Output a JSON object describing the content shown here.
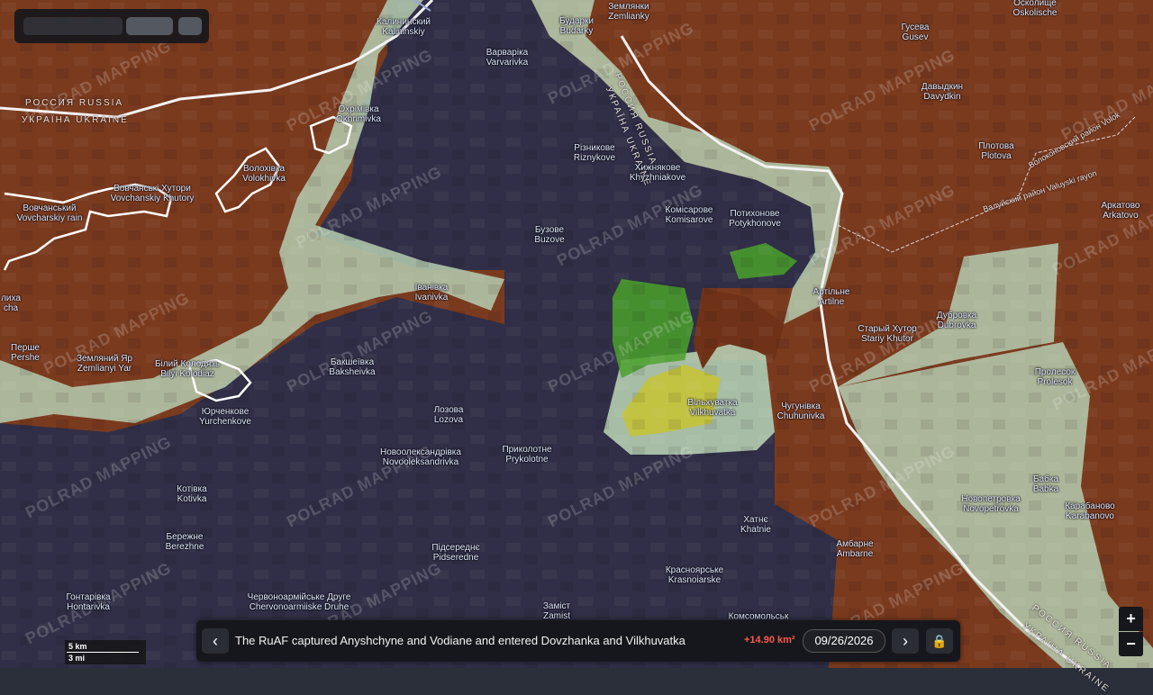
{
  "map": {
    "watermark": "POLRAD MAPPING",
    "border_labels": {
      "russia": "РОССИЯ RUSSIA",
      "ukraine": "УКРАЇНА UKRAINE",
      "russia_diag": "РОССИЯ RUSSIA",
      "ukraine_diag": "УКРАЇНА UKRAINE"
    },
    "district_labels": {
      "volokonovsky": "Волоконовский район Volok",
      "valuysky": "Валуйский район Valuyski rayon"
    },
    "places": [
      {
        "id": "kalinin",
        "ru": "Калининский",
        "en": "Kalininskiy"
      },
      {
        "id": "varvarivka",
        "ru": "Варваріка",
        "en": "Varvarivka"
      },
      {
        "id": "budarky",
        "ru": "Бударки",
        "en": "Budarky"
      },
      {
        "id": "zemlyanky",
        "ru": "Землянки",
        "en": "Zemlianky"
      },
      {
        "id": "oskolishe",
        "ru": "Осколище",
        "en": "Oskolische"
      },
      {
        "id": "gusev",
        "ru": "Гусева",
        "en": "Gusev"
      },
      {
        "id": "davydkin",
        "ru": "Давыдкин",
        "en": "Davydkin"
      },
      {
        "id": "okhrimivka",
        "ru": "Охрімівка",
        "en": "Okhrimivka"
      },
      {
        "id": "riznykove",
        "ru": "Різникове",
        "en": "Riznykove"
      },
      {
        "id": "khyzhniakove",
        "ru": "Хижнякове",
        "en": "Khyzhniakove"
      },
      {
        "id": "plotova",
        "ru": "Плотова",
        "en": "Plotova"
      },
      {
        "id": "volokhivka",
        "ru": "Волохівка",
        "en": "Volokhivka"
      },
      {
        "id": "vovchansky",
        "ru": "Вовчанські Хутори",
        "en": "Vovchanskiy Khutory"
      },
      {
        "id": "vovchansky2",
        "ru": "Вовчанський",
        "en": "Vovcharskiy rain"
      },
      {
        "id": "komisarove",
        "ru": "Комісарове",
        "en": "Komisarove"
      },
      {
        "id": "potykhonove",
        "ru": "Потихонове",
        "en": "Potykhonove"
      },
      {
        "id": "buzove",
        "ru": "Бузове",
        "en": "Buzove"
      },
      {
        "id": "arkatove",
        "ru": "Аркатово",
        "en": "Arkatovo"
      },
      {
        "id": "ivanivka",
        "ru": "Іванівка",
        "en": "Ivanivka"
      },
      {
        "id": "artilne",
        "ru": "Артільне",
        "en": "Artilne"
      },
      {
        "id": "staryi",
        "ru": "Старый Хутор",
        "en": "Stariy Khutor"
      },
      {
        "id": "dubrovka",
        "ru": "Дубровка",
        "en": "Dubrovka"
      },
      {
        "id": "lyha",
        "ru": "лиха",
        "en": "cha"
      },
      {
        "id": "pershe",
        "ru": "Перше",
        "en": "Pershe"
      },
      {
        "id": "zemlianyi",
        "ru": "Земляний Яр",
        "en": "Zemlianyi Yar"
      },
      {
        "id": "bilyi",
        "ru": "Білий Колодязь",
        "en": "Bilyi Kolodiaz"
      },
      {
        "id": "bakshe",
        "ru": "Бакшеївка",
        "en": "Baksheivka"
      },
      {
        "id": "vilkhuvatka",
        "ru": "Вільхуватка",
        "en": "Vilkhuvatka"
      },
      {
        "id": "chuhunivka",
        "ru": "Чугунівка",
        "en": "Chuhunivka"
      },
      {
        "id": "prolesok",
        "ru": "Пролесок",
        "en": "Prolesok"
      },
      {
        "id": "yurchenkove",
        "ru": "Юрченкове",
        "en": "Yurchenkove"
      },
      {
        "id": "lozova",
        "ru": "Лозова",
        "en": "Lozova"
      },
      {
        "id": "novoolek",
        "ru": "Новоолександрівка",
        "en": "Novooleksandrivka"
      },
      {
        "id": "prykolotne",
        "ru": "Приколотне",
        "en": "Prykolotne"
      },
      {
        "id": "babka",
        "ru": "Бабка",
        "en": "Babka"
      },
      {
        "id": "kotivka",
        "ru": "Котівка",
        "en": "Kotivka"
      },
      {
        "id": "novopetrovka",
        "ru": "Новопетровка",
        "en": "Novopetrovka"
      },
      {
        "id": "karabanovo",
        "ru": "Карабаново",
        "en": "Karabanovo"
      },
      {
        "id": "khatne",
        "ru": "Хатнє",
        "en": "Khatnie"
      },
      {
        "id": "berezhne",
        "ru": "Бережне",
        "en": "Berezhne"
      },
      {
        "id": "ambarne",
        "ru": "Амбарне",
        "en": "Ambarne"
      },
      {
        "id": "pidseredne",
        "ru": "Підсереднє",
        "en": "Pidseredne"
      },
      {
        "id": "krasnoyar",
        "ru": "Красноярське",
        "en": "Krasnoiarske"
      },
      {
        "id": "hontarivka",
        "ru": "Гонтарівка",
        "en": "Hontarivka"
      },
      {
        "id": "chervono",
        "ru": "Червоноармійське Друге",
        "en": "Chervonoarmiiske Druhe"
      },
      {
        "id": "zamist",
        "ru": "Заміст",
        "en": "Zamist"
      },
      {
        "id": "komsomol",
        "ru": "",
        "en": "Комсомольськ"
      }
    ]
  },
  "timeline": {
    "prev_label": "‹",
    "next_label": "›",
    "description": "The RuAF captured Anyshchyne and Vodiane and entered Dovzhanka and Vilkhuvatka",
    "area_change": "+14.90 km²",
    "date": "09/26/2026"
  },
  "zoom": {
    "in_label": "+",
    "out_label": "−"
  },
  "scale": {
    "km": "5 km",
    "mi": "3 mi"
  },
  "colors": {
    "russian": "#7a3a1e",
    "russian_dark": "#6a2f16",
    "ukrainian": "#2f2e45",
    "contested": "#b8d2b0",
    "gain_green": "#4aa02c",
    "gain_yellow": "#c9c32a",
    "border": "#f2f2f2"
  }
}
